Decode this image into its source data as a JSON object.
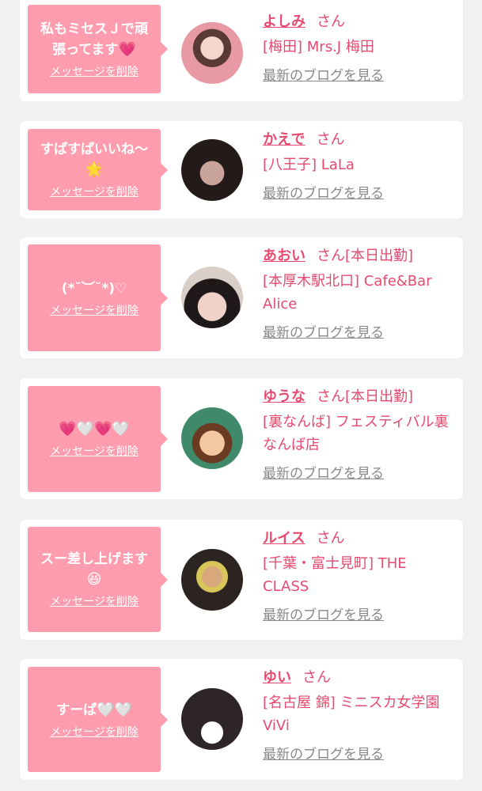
{
  "cards": [
    {
      "message": "私もミセスＪで頑張ってます",
      "emoji": "💗",
      "delete_label": "メッセージを削除",
      "name": "よしみ",
      "honorific": "さん",
      "status": "",
      "shop": "[梅田] Mrs.J 梅田",
      "blog_label": "最新のブログを見る"
    },
    {
      "message": "すぱすぱいいね〜",
      "emoji": "🌟",
      "delete_label": "メッセージを削除",
      "name": "かえで",
      "honorific": "さん",
      "status": "",
      "shop": "[八王子] LaLa",
      "blog_label": "最新のブログを見る"
    },
    {
      "message": "(*˘︶˘*)♡",
      "emoji": "",
      "delete_label": "メッセージを削除",
      "name": "あおい",
      "honorific": "さん",
      "status": "[本日出勤]",
      "shop": "[本厚木駅北口] Cafe&Bar Alice",
      "blog_label": "最新のブログを見る"
    },
    {
      "message": "",
      "emoji": "💗🤍💗🤍",
      "delete_label": "メッセージを削除",
      "name": "ゆうな",
      "honorific": "さん",
      "status": "[本日出勤]",
      "shop": "[裏なんば] フェスティバル裏なんば店",
      "blog_label": "最新のブログを見る"
    },
    {
      "message": "スー差し上げます",
      "emoji": "😆",
      "delete_label": "メッセージを削除",
      "name": "ルイス",
      "honorific": "さん",
      "status": "",
      "shop": "[千葉・富士見町] THE CLASS",
      "blog_label": "最新のブログを見る"
    },
    {
      "message": "すーぱ",
      "emoji": "🤍🤍",
      "delete_label": "メッセージを削除",
      "name": "ゆい",
      "honorific": "さん",
      "status": "",
      "shop": "[名古屋 錦] ミニスカ女学園ViVi",
      "blog_label": "最新のブログを見る"
    }
  ]
}
